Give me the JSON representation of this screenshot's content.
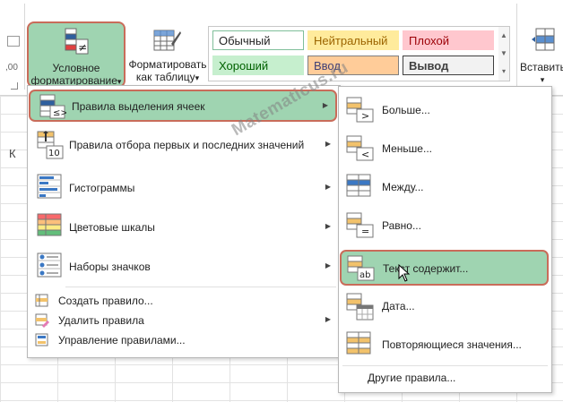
{
  "ribbon": {
    "left_number": ",00",
    "conditional_formatting_button": {
      "line1": "Условное",
      "line2": "форматирование",
      "arrow": "▾"
    },
    "format_as_table_button": {
      "line1": "Форматировать",
      "line2": "как таблицу",
      "arrow": "▾"
    },
    "cell_styles": [
      {
        "label": "Обычный",
        "bg": "#ffffff",
        "border": "#7fbf9a",
        "color": "#222222"
      },
      {
        "label": "Нейтральный",
        "bg": "#ffeb9c",
        "border": "#ffeb9c",
        "color": "#9c6500"
      },
      {
        "label": "Плохой",
        "bg": "#ffc7ce",
        "border": "#ffc7ce",
        "color": "#9c0006"
      },
      {
        "label": "Хороший",
        "bg": "#c6efce",
        "border": "#c6efce",
        "color": "#006100"
      },
      {
        "label": "Ввод",
        "bg": "#ffcc99",
        "border": "#7f7f7f",
        "color": "#3f3f76"
      },
      {
        "label": "Вывод",
        "bg": "#f2f2f2",
        "border": "#3f3f3f",
        "color": "#3f3f3f"
      }
    ],
    "insert_button": {
      "label": "Вставить",
      "arrow": "▾"
    }
  },
  "grid": {
    "column_letter": "К"
  },
  "menu": {
    "items": [
      {
        "label": "Правила выделения ячеек",
        "has_submenu": true,
        "highlighted": true,
        "icon": "highlight-cells-rules-icon"
      },
      {
        "label": "Правила отбора первых и последних значений",
        "has_submenu": true,
        "icon": "top-bottom-rules-icon"
      },
      {
        "label": "Гистограммы",
        "has_submenu": true,
        "icon": "data-bars-icon"
      },
      {
        "label": "Цветовые шкалы",
        "has_submenu": true,
        "icon": "color-scales-icon"
      },
      {
        "label": "Наборы значков",
        "has_submenu": true,
        "icon": "icon-sets-icon"
      }
    ],
    "small_items": [
      {
        "label": "Создать правило...",
        "icon": "new-rule-icon"
      },
      {
        "label": "Удалить правила",
        "has_submenu": true,
        "icon": "clear-rules-icon"
      },
      {
        "label": "Управление правилами...",
        "icon": "manage-rules-icon"
      }
    ]
  },
  "submenu": {
    "items": [
      {
        "label": "Больше...",
        "icon": "greater-than-icon",
        "symbol": ">"
      },
      {
        "label": "Меньше...",
        "icon": "less-than-icon",
        "symbol": "<"
      },
      {
        "label": "Между...",
        "icon": "between-icon",
        "symbol": ""
      },
      {
        "label": "Равно...",
        "icon": "equal-to-icon",
        "symbol": "="
      },
      {
        "label": "Текст содержит...",
        "icon": "text-contains-icon",
        "symbol": "ab",
        "highlighted": true
      },
      {
        "label": "Дата...",
        "icon": "date-occurring-icon",
        "symbol": ""
      },
      {
        "label": "Повторяющиеся значения...",
        "icon": "duplicate-values-icon",
        "symbol": ""
      }
    ],
    "footer": "Другие правила..."
  },
  "watermark": "Matematicus.ru",
  "accent_color": "#9fd4b1",
  "highlight_border_color": "#c96c5a"
}
